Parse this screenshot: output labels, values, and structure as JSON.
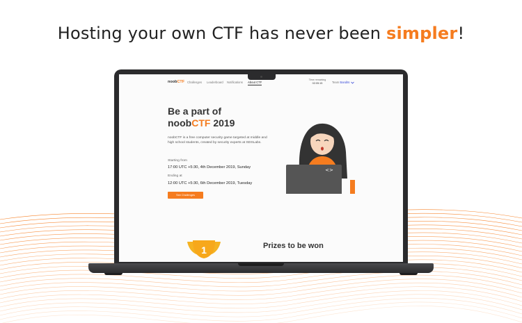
{
  "headline": {
    "prefix": "Hosting your own CTF has never been ",
    "accent": "simpler",
    "suffix": "!"
  },
  "colors": {
    "accent": "#f57c1f",
    "team_link": "#3a4bd8",
    "laptop": "#2b2b2d"
  },
  "nav": {
    "logo_prefix": "noob",
    "logo_accent": "CTF",
    "links": [
      "Challenges",
      "Leaderboard",
      "Notifications",
      "About CTF"
    ],
    "active_link": "About CTF",
    "timer_label": "Time remaining",
    "timer_value": "02:05:15",
    "team_label": "Team",
    "team_name": "Bandits",
    "team_icon": "chevron-down-icon"
  },
  "hero": {
    "title_line1": "Be a part of",
    "title_prefix": "noob",
    "title_accent": "CTF",
    "title_year": " 2019",
    "description": "noobCTF is a free computer security game targeted at middle and high school students, created by security experts at SDSLabs.",
    "start_label": "Starting from",
    "start_value": "17:00 UTC +5:30, 4th December 2019, Sunday",
    "end_label": "Ending at",
    "end_value": "12:00  UTC +5:30, 6th December 2019, Tuesday",
    "cta_label": "See Challenges",
    "illustration": "hooded-hacker-laptop-illustration",
    "code_icon": "<>"
  },
  "prizes": {
    "title": "Prizes to be won",
    "trophy_number": "1"
  }
}
